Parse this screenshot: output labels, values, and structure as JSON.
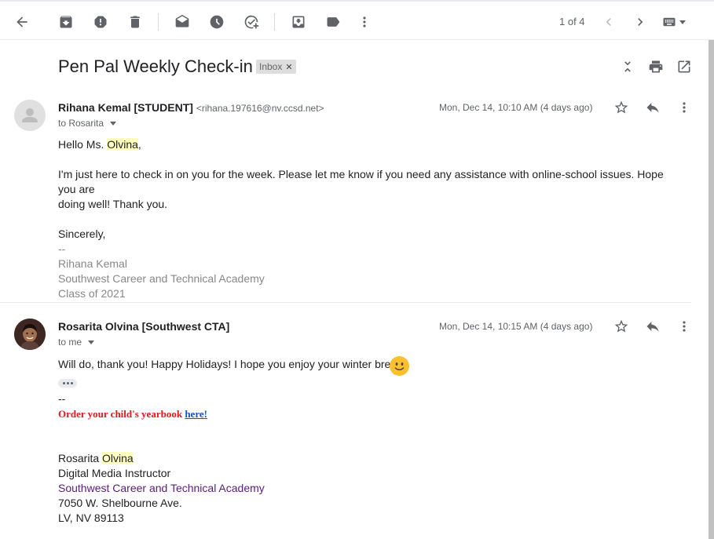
{
  "toolbar": {
    "pager_text": "1 of 4"
  },
  "subject": "Pen Pal Weekly Check-in",
  "label_chip": "Inbox",
  "messages": [
    {
      "sender_name": "Rihana Kemal [STUDENT]",
      "sender_email": "<rihana.197616@nv.ccsd.net>",
      "to_text": "to Rosarita",
      "date": "Mon, Dec 14, 10:10 AM (4 days ago)",
      "greeting_pre": "Hello Ms. ",
      "greeting_name": "Olvina",
      "greeting_post": ",",
      "para1_line1": "I'm just here to check in on you for the week. Please let me know if you need any assistance with online-school issues. Hope you are",
      "para1_line2": "doing well! Thank you.",
      "closing": "Sincerely,",
      "sig_dashes": "--",
      "sig_name": "Rihana Kemal",
      "sig_school": "Southwest Career and Technical Academy",
      "sig_class": "Class of 2021"
    },
    {
      "sender_name": "Rosarita Olvina [Southwest CTA]",
      "to_text": "to me",
      "date": "Mon, Dec 14, 10:15 AM (4 days ago)",
      "body_line": "Will do, thank you! Happy Holidays! I hope you enjoy your winter break.",
      "sig_dashes": "--",
      "yearbook_text": "Order your child's yearbook ",
      "yearbook_link": "here!",
      "sig_first": "Rosarita ",
      "sig_last": "Olvina",
      "sig_title": "Digital Media Instructor",
      "sig_school": "Southwest Career and Technical Academy",
      "sig_address": "7050 W. Shelbourne Ave.",
      "sig_city": "LV, NV  89113"
    }
  ],
  "colors": {
    "highlight": "#ffffc0",
    "yearbook_red": "#e01b1b",
    "link_blue": "#1155cc",
    "school_purple": "#5b1b7a"
  },
  "icons": {
    "toolbar": [
      "back-arrow-icon",
      "archive-icon",
      "report-spam-icon",
      "delete-icon",
      "mark-unread-icon",
      "snooze-icon",
      "add-task-icon",
      "move-to-icon",
      "label-icon",
      "more-vert-icon",
      "chevron-left-icon",
      "chevron-right-icon",
      "keyboard-icon"
    ],
    "header": [
      "collapse-all-icon",
      "print-icon",
      "open-new-window-icon"
    ],
    "message": [
      "star-icon",
      "reply-icon",
      "more-vert-icon"
    ]
  }
}
